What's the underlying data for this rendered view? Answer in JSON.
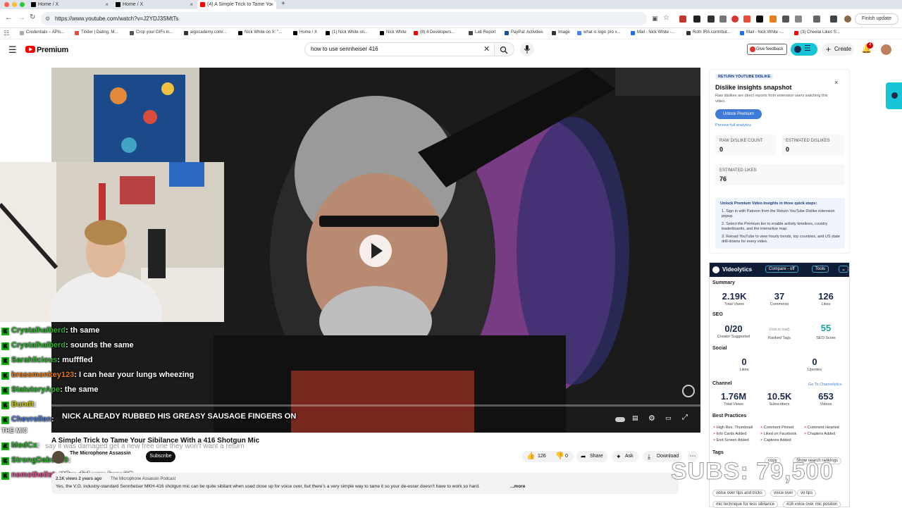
{
  "browser": {
    "tabs": [
      {
        "label": "Home / X"
      },
      {
        "label": "Home / X"
      },
      {
        "label": "(4) A Simple Trick to Tame Yo"
      }
    ],
    "new_tab": "+",
    "url": "https://www.youtube.com/watch?v=J2YDJ3SMtTs",
    "finish_update": "Finish update",
    "bookmarks": [
      "Credentials – APIs...",
      "Tinder | Dating, M...",
      "Crop your GIFs in...",
      "algocademy.com/...",
      "Nick White on X: \"...",
      "Home / X",
      "(1) Nick White on...",
      "Nick White",
      "(8) 4 Developers...",
      "Lab Report",
      "PayPal: Activities",
      "Image",
      "what is logic pro x...",
      "Mail - Nick White -...",
      "Roth IRA contribut...",
      "Mail - Nick White -...",
      "(3) Cheelai Likes S..."
    ]
  },
  "youtube": {
    "logo": "Premium",
    "search_value": "how to use sennheiser 416",
    "give_feedback": "Give feedback",
    "create": "Create",
    "notif_count": "4"
  },
  "video": {
    "caption": "NICK ALREADY RUBBED HIS GREASY SAUSAGE FINGERS ON",
    "title": "A Simple Trick to Tame Your Sibilance With a 416 Shotgun Mic",
    "channel": "The Microphone Assassin",
    "subscribe": "Subscribe",
    "likes": "126",
    "dislikes": "0",
    "share": "Share",
    "ask": "Ask",
    "download": "Download",
    "views": "2.1K views  2 years ago",
    "channel_link": "The Microphone Assassin Podcast",
    "description": "Yes, the V.O. industry-standard Sennheiser MKH-416 shotgun mic can be quite sibilant when used close up for voice over, but there's a very simple way to tame it so your de-esser doesn't have to work so hard.",
    "more": "...more"
  },
  "overlay": {
    "watermark": "SUBS: 79,500",
    "overlap_text": "say it was damaged get a new free one they won't want a return",
    "the_mic": "THE MIC"
  },
  "chat": [
    {
      "user": "Crystalhalberd",
      "msg": ": th same"
    },
    {
      "user": "Crystalhalberd",
      "msg": ": sounds the same"
    },
    {
      "user": "Sarahlicious",
      "msg": ": mufffled"
    },
    {
      "user": "brassmonkey123",
      "msg": ": I can hear your lungs wheezing"
    },
    {
      "user": "StatutoryApe",
      "msg": ": the same"
    },
    {
      "user": "Bundt",
      "msg": ":"
    },
    {
      "user": "Chevrollen",
      "msg": ":"
    },
    {
      "user": "ModCx",
      "msg": ":"
    },
    {
      "user": "StrongDabs420",
      "msg": ":"
    },
    {
      "user": "nemotheilst",
      "msg": ": Why did you buy it?"
    }
  ],
  "dislike_panel": {
    "tag": "RETURN YOUTUBE DISLIKE",
    "title": "Dislike insights snapshot",
    "desc": "Raw dislikes are direct reports from extension users watching this video.",
    "unlock": "Unlock Premium",
    "preview": "Preview full analytics",
    "raw_label": "RAW DISLIKE COUNT",
    "raw_value": "0",
    "est_dislikes_label": "ESTIMATED DISLIKES",
    "est_dislikes_value": "0",
    "est_likes_label": "ESTIMATED LIKES",
    "est_likes_value": "76",
    "steps_title": "Unlock Premium Video Insights in three quick steps:",
    "steps": [
      "Sign in with Patreon from the Return YouTube Dislike extension popup.",
      "Select the Premium tier to enable activity timelines, country leaderboards, and the interactive map.",
      "Reload YouTube to view hourly trends, top countries, and US state drill-downs for every video."
    ]
  },
  "videolytics": {
    "name": "Videolytics",
    "compare": "Compare - off",
    "tools": "Tools",
    "summary": "Summary",
    "total_views": "2.19K",
    "total_views_l": "Total Views",
    "comments": "37",
    "comments_l": "Comments",
    "likes": "126",
    "likes_l": "Likes",
    "seo": "SEO",
    "creator_suggested": "0/20",
    "creator_suggested_l": "Creator Suggested",
    "ranked_tags_hint": "(click to load)",
    "ranked_tags_l": "Ranked Tags",
    "seo_score": "55",
    "seo_score_l": "SEO Score",
    "social": "Social",
    "s_likes": "0",
    "s_likes_l": "Likes",
    "upvotes": "0",
    "upvotes_l": "Upvotes",
    "channel": "Channel",
    "goto": "Go To Channelytics",
    "ch_views": "1.76M",
    "ch_views_l": "Total Views",
    "subs": "10.5K",
    "subs_l": "Subscribers",
    "videos": "653",
    "videos_l": "Videos",
    "best": "Best Practices",
    "practices": [
      "High Res. Thumbnail",
      "Comment Pinned",
      "Comment Hearted",
      "Info Cards Added",
      "Liked on Facebook",
      "Chapters Added",
      "End Screen Added",
      "Captions Added"
    ],
    "tags": "Tags",
    "copy": "copy",
    "show_rankings": "Show search rankings",
    "tag_list": [
      "voice over tips and tricks",
      "voice over",
      "vo tips",
      "mic technique for less sibilance",
      "416 voice over mic position"
    ]
  },
  "colors": {
    "yt_red": "#ff0000",
    "chat_green": "#2db02d",
    "accent_blue": "#3e7bd9"
  }
}
